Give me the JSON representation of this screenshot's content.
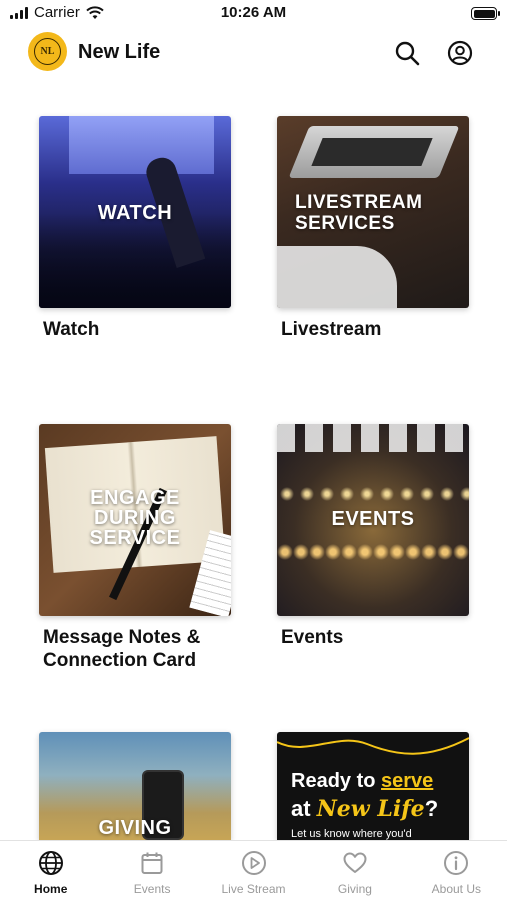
{
  "status_bar": {
    "carrier": "Carrier",
    "time": "10:26 AM"
  },
  "header": {
    "logo_text": "NL",
    "title": "New Life"
  },
  "icons": {
    "search": "search-icon",
    "account": "account-circle-icon"
  },
  "tiles": [
    {
      "overlay": "WATCH",
      "caption": "Watch"
    },
    {
      "overlay": "LIVESTREAM SERVICES",
      "caption": "Livestream"
    },
    {
      "overlay": "ENGAGE DURING SERVICE",
      "caption": "Message Notes & Connection Card"
    },
    {
      "overlay": "EVENTS",
      "caption": "Events"
    },
    {
      "overlay": "GIVING",
      "caption": ""
    },
    {
      "promo_line1_a": "Ready to ",
      "promo_line1_b": "serve",
      "promo_line2_a": "at ",
      "promo_line2_b": "New Life",
      "promo_line2_c": "?",
      "promo_sub": "Let us know where you'd",
      "caption": ""
    }
  ],
  "nav": [
    {
      "label": "Home",
      "icon": "globe-icon",
      "active": true
    },
    {
      "label": "Events",
      "icon": "calendar-icon",
      "active": false
    },
    {
      "label": "Live Stream",
      "icon": "play-circle-icon",
      "active": false
    },
    {
      "label": "Giving",
      "icon": "heart-icon",
      "active": false
    },
    {
      "label": "About Us",
      "icon": "info-circle-icon",
      "active": false
    }
  ],
  "colors": {
    "brand_yellow": "#f3b81a",
    "promo_yellow": "#f5c518",
    "nav_inactive": "#9a9a9a"
  }
}
